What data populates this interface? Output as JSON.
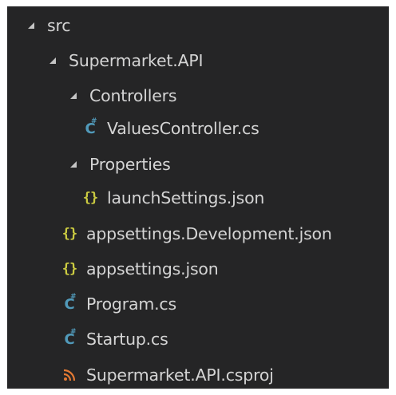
{
  "explorer": {
    "items": [
      {
        "label": "src",
        "type": "folder",
        "expanded": true,
        "depth": 0
      },
      {
        "label": "Supermarket.API",
        "type": "folder",
        "expanded": true,
        "depth": 1
      },
      {
        "label": "Controllers",
        "type": "folder",
        "expanded": true,
        "depth": 2
      },
      {
        "label": "ValuesController.cs",
        "type": "csharp-file",
        "icon": "csharp-icon",
        "depth": 3
      },
      {
        "label": "Properties",
        "type": "folder",
        "expanded": true,
        "depth": 2
      },
      {
        "label": "launchSettings.json",
        "type": "json-file",
        "icon": "json-icon",
        "depth": 3
      },
      {
        "label": "appsettings.Development.json",
        "type": "json-file",
        "icon": "json-icon",
        "depth": 2
      },
      {
        "label": "appsettings.json",
        "type": "json-file",
        "icon": "json-icon",
        "depth": 2
      },
      {
        "label": "Program.cs",
        "type": "csharp-file",
        "icon": "csharp-icon",
        "depth": 2
      },
      {
        "label": "Startup.cs",
        "type": "csharp-file",
        "icon": "csharp-icon",
        "depth": 2
      },
      {
        "label": "Supermarket.API.csproj",
        "type": "project-file",
        "icon": "rss-icon",
        "depth": 2
      }
    ]
  },
  "colors": {
    "background": "#252526",
    "text": "#d4d4d4",
    "csharp": "#519aba",
    "json": "#cbcb41",
    "csproj": "#e37933"
  }
}
